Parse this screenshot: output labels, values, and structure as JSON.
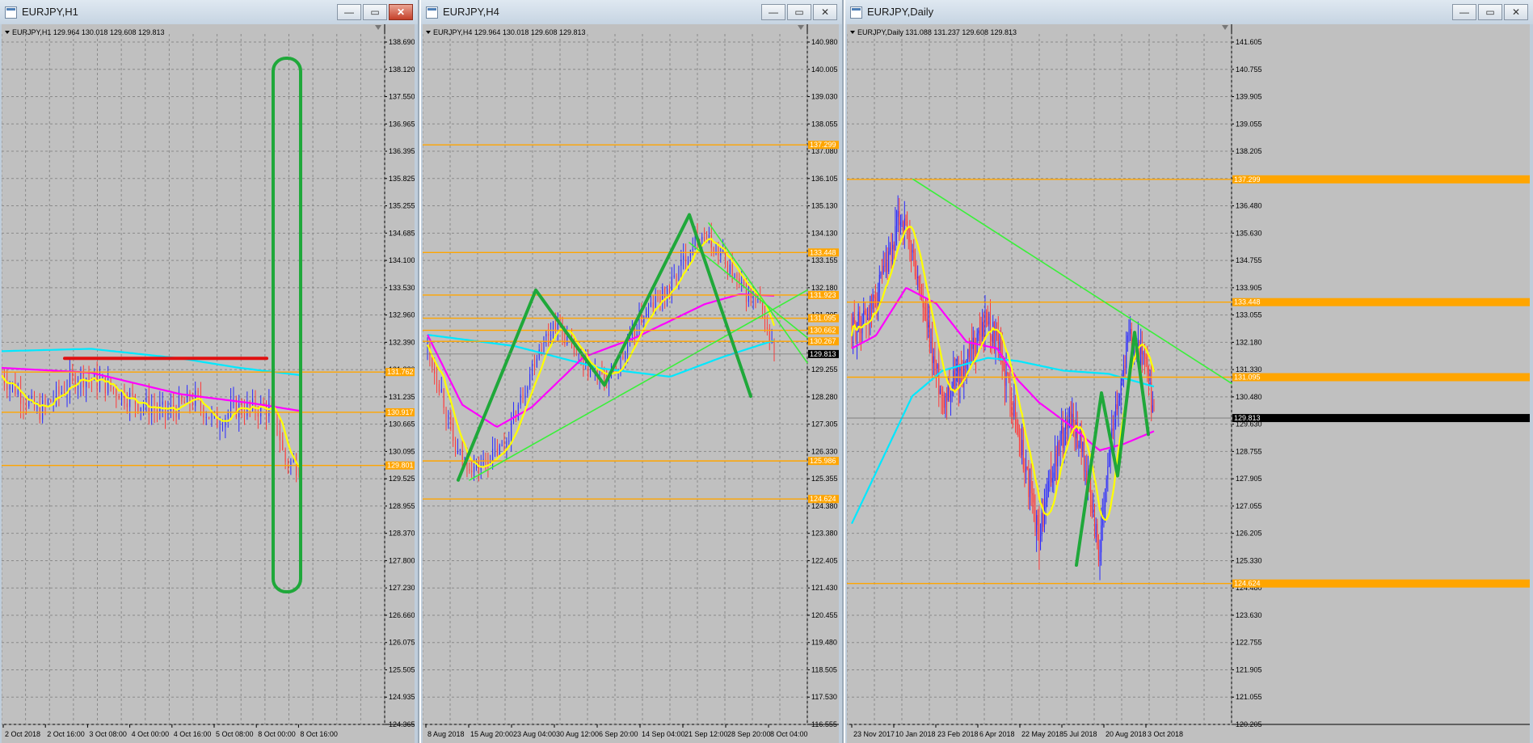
{
  "windows": [
    {
      "id": "h1",
      "title": "EURJPY,H1",
      "info": "EURJPY,H1  129.964 130.018 129.608 129.813",
      "prices": [
        "138.690",
        "138.120",
        "137.550",
        "136.965",
        "136.395",
        "135.825",
        "135.255",
        "134.685",
        "134.100",
        "133.530",
        "132.960",
        "132.390",
        "131.820",
        "131.235",
        "130.665",
        "130.095",
        "129.525",
        "128.955",
        "128.370",
        "127.800",
        "127.230",
        "126.660",
        "126.075",
        "125.505",
        "124.935",
        "124.365"
      ],
      "dates": [
        "2 Oct 2018",
        "2 Oct 16:00",
        "3 Oct 08:00",
        "4 Oct 00:00",
        "4 Oct 16:00",
        "5 Oct 08:00",
        "8 Oct 00:00",
        "8 Oct 16:00"
      ],
      "hlines": [
        {
          "label": "131.762",
          "value": 131.762
        },
        {
          "label": "130.917",
          "value": 130.917
        },
        {
          "label": "129.801",
          "value": 129.801
        }
      ],
      "active_tag": "",
      "close_value": 129.813
    },
    {
      "id": "h4",
      "title": "EURJPY,H4",
      "info": "EURJPY,H4  129.964 130.018 129.608 129.813",
      "prices": [
        "140.980",
        "140.005",
        "139.030",
        "138.055",
        "137.080",
        "136.105",
        "135.130",
        "134.130",
        "133.155",
        "132.180",
        "131.205",
        "130.230",
        "129.255",
        "128.280",
        "127.305",
        "126.330",
        "125.355",
        "124.380",
        "123.380",
        "122.405",
        "121.430",
        "120.455",
        "119.480",
        "118.505",
        "117.530",
        "116.555"
      ],
      "dates": [
        "8 Aug 2018",
        "15 Aug 20:00",
        "23 Aug 04:00",
        "30 Aug 12:00",
        "6 Sep 20:00",
        "14 Sep 04:00",
        "21 Sep 12:00",
        "28 Sep 20:00",
        "8 Oct 04:00"
      ],
      "hlines": [
        {
          "label": "137.299",
          "value": 137.299
        },
        {
          "label": "133.448",
          "value": 133.448
        },
        {
          "label": "131.923",
          "value": 131.923
        },
        {
          "label": "131.095",
          "value": 131.095
        },
        {
          "label": "130.662",
          "value": 130.662
        },
        {
          "label": "130.267",
          "value": 130.267
        },
        {
          "label": "125.986",
          "value": 125.986
        },
        {
          "label": "124.624",
          "value": 124.624
        }
      ],
      "active_tag": "129.813",
      "close_value": 129.813
    },
    {
      "id": "d1",
      "title": "EURJPY,Daily",
      "info": "EURJPY,Daily  131.088 131.237 129.608 129.813",
      "prices": [
        "141.605",
        "140.755",
        "139.905",
        "139.055",
        "138.205",
        "137.355",
        "136.480",
        "135.630",
        "134.755",
        "133.905",
        "133.055",
        "132.180",
        "131.330",
        "130.480",
        "129.630",
        "128.755",
        "127.905",
        "127.055",
        "126.205",
        "125.330",
        "124.480",
        "123.630",
        "122.755",
        "121.905",
        "121.055",
        "120.205"
      ],
      "dates": [
        "23 Nov 2017",
        "10 Jan 2018",
        "23 Feb 2018",
        "6 Apr 2018",
        "22 May 2018",
        "5 Jul 2018",
        "20 Aug 2018",
        "3 Oct 2018"
      ],
      "hlines": [
        {
          "label": "137.299",
          "value": 137.299
        },
        {
          "label": "133.448",
          "value": 133.448
        },
        {
          "label": "131.095",
          "value": 131.095
        },
        {
          "label": "124.624",
          "value": 124.624
        }
      ],
      "active_tag": "129.813",
      "close_value": 129.813
    }
  ],
  "colors": {
    "chart_bg": "#c0c0c0",
    "grid": "#8a8a8a",
    "hline": "#ffa500",
    "bull_candle": "#2a2aff",
    "bear_candle": "#ff3a3a",
    "ma_fast": "#ffff00",
    "ma_mid": "#ff00ff",
    "ma_slow": "#00e8ff",
    "trend_light": "#3af03a",
    "trend_dark": "#1fa83a",
    "resistance_red": "#e01010",
    "text": "#000000"
  }
}
